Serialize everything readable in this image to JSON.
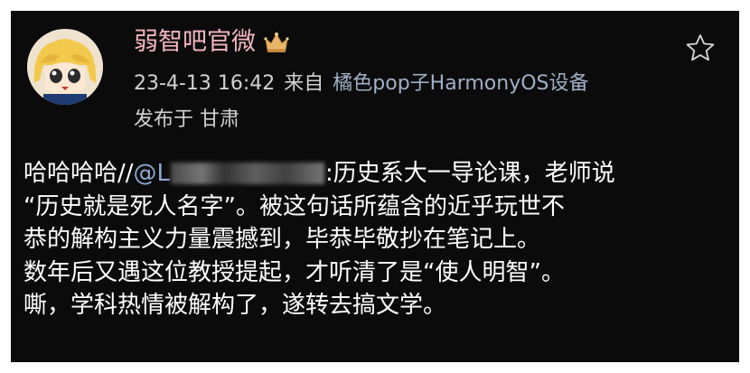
{
  "post": {
    "username": "弱智吧官微",
    "timestamp": "23-4-13 16:42",
    "source_prefix": "来自",
    "source_device": "橘色pop子HarmonyOS设备",
    "location": "发布于 甘肃",
    "content": {
      "prefix": "哈哈哈哈//",
      "mention": "@L",
      "line1_rest": ":历史系大一导论课，老师说",
      "line2": "“历史就是死人名字”。被这句话所蕴含的近乎玩世不",
      "line3": "恭的解构主义力量震撼到，毕恭毕敬抄在笔记上。",
      "line4": "数年后又遇这位教授提起，才听清了是“使人明智”。",
      "line5": "嘶，学科热情被解构了，遂转去搞文学。"
    }
  },
  "icons": {
    "vip": "crown-badge-icon",
    "favorite": "star-outline-icon"
  },
  "colors": {
    "background": "#0b0b0b",
    "username": "#f4b6bf",
    "meta_text": "#d2d2d2",
    "link": "#9fb0c7",
    "mention": "#8ea8cf",
    "content_text": "#ffffff"
  }
}
